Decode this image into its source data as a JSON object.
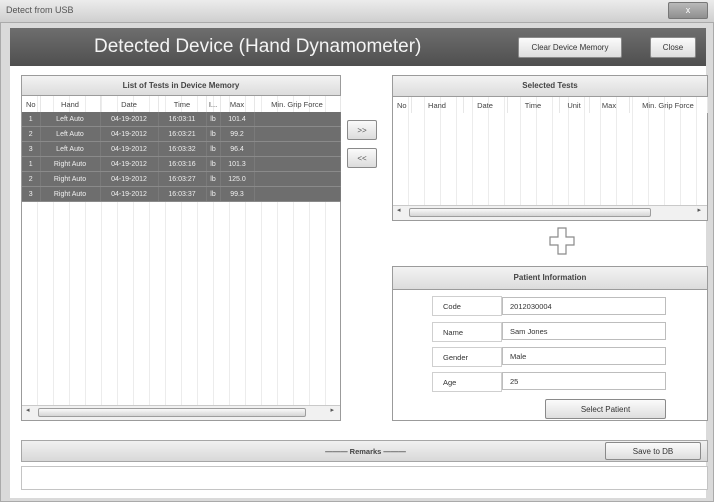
{
  "window": {
    "title": "Detect from USB",
    "close_glyph": "x"
  },
  "header": {
    "title": "Detected Device (Hand Dynamometer)",
    "clear_button": "Clear Device Memory",
    "close_button": "Close"
  },
  "left_panel": {
    "title": "List of Tests in Device Memory",
    "columns": [
      "No",
      "Hand",
      "Date",
      "Time",
      "I...",
      "Max",
      "Min. Grip Force"
    ],
    "rows": [
      {
        "no": "1",
        "hand": "Left Auto",
        "date": "04-19-2012",
        "time": "16:03:11",
        "unit": "lb",
        "max": "101.4",
        "min": ""
      },
      {
        "no": "2",
        "hand": "Left Auto",
        "date": "04-19-2012",
        "time": "16:03:21",
        "unit": "lb",
        "max": "99.2",
        "min": ""
      },
      {
        "no": "3",
        "hand": "Left Auto",
        "date": "04-19-2012",
        "time": "16:03:32",
        "unit": "lb",
        "max": "96.4",
        "min": ""
      },
      {
        "no": "1",
        "hand": "Right Auto",
        "date": "04-19-2012",
        "time": "16:03:16",
        "unit": "lb",
        "max": "101.3",
        "min": ""
      },
      {
        "no": "2",
        "hand": "Right Auto",
        "date": "04-19-2012",
        "time": "16:03:27",
        "unit": "lb",
        "max": "125.0",
        "min": ""
      },
      {
        "no": "3",
        "hand": "Right Auto",
        "date": "04-19-2012",
        "time": "16:03:37",
        "unit": "lb",
        "max": "99.3",
        "min": ""
      }
    ]
  },
  "transfer": {
    "add_label": ">>",
    "remove_label": "<<"
  },
  "right_panel": {
    "title": "Selected Tests",
    "columns": [
      "No",
      "Hand",
      "Date",
      "Time",
      "Unit",
      "Max",
      "Min. Grip Force"
    ]
  },
  "patient": {
    "title": "Patient Information",
    "code_label": "Code",
    "code_value": "2012030004",
    "name_label": "Name",
    "name_value": "Sam Jones",
    "gender_label": "Gender",
    "gender_value": "Male",
    "age_label": "Age",
    "age_value": "25",
    "select_button": "Select Patient"
  },
  "remarks": {
    "label": "——— Remarks ———",
    "save_button": "Save to DB",
    "value": ""
  },
  "icons": {
    "cross": "plus-outline-icon",
    "scroll_left": "scroll-left-icon",
    "scroll_right": "scroll-right-icon"
  }
}
